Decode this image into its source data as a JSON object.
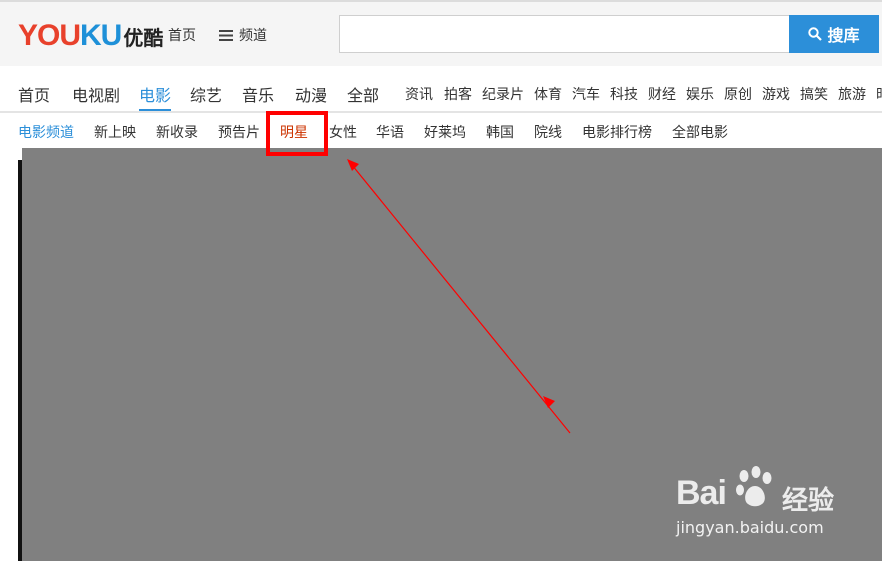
{
  "header": {
    "logo_en_part1": "YOU",
    "logo_en_part2": "KU",
    "logo_cn": "优酷",
    "home_link": "首页",
    "channel_link": "频道",
    "search_value": "",
    "search_placeholder": "",
    "search_button": "搜库"
  },
  "main_nav": {
    "items": [
      "首页",
      "电视剧",
      "电影",
      "综艺",
      "音乐",
      "动漫",
      "全部"
    ],
    "small_items": [
      "资讯",
      "拍客",
      "纪录片",
      "体育",
      "汽车",
      "科技",
      "财经",
      "娱乐",
      "原创",
      "游戏",
      "搞笑",
      "旅游",
      "时"
    ],
    "active": "电影"
  },
  "sub_nav": {
    "items": [
      "电影频道",
      "新上映",
      "新收录",
      "预告片",
      "明星",
      "女性",
      "华语",
      "好莱坞",
      "韩国",
      "院线",
      "电影排行榜",
      "全部电影"
    ],
    "active": "电影频道",
    "highlighted": "明星"
  },
  "watermark": {
    "brand_left": "Bai",
    "brand_right": "经验",
    "url": "jingyan.baidu.com"
  },
  "colors": {
    "accent": "#2c8fd9",
    "logo_red": "#e8412c",
    "logo_blue": "#1e90d8",
    "annotation_red": "#ff0000",
    "content_gray": "#808080"
  }
}
